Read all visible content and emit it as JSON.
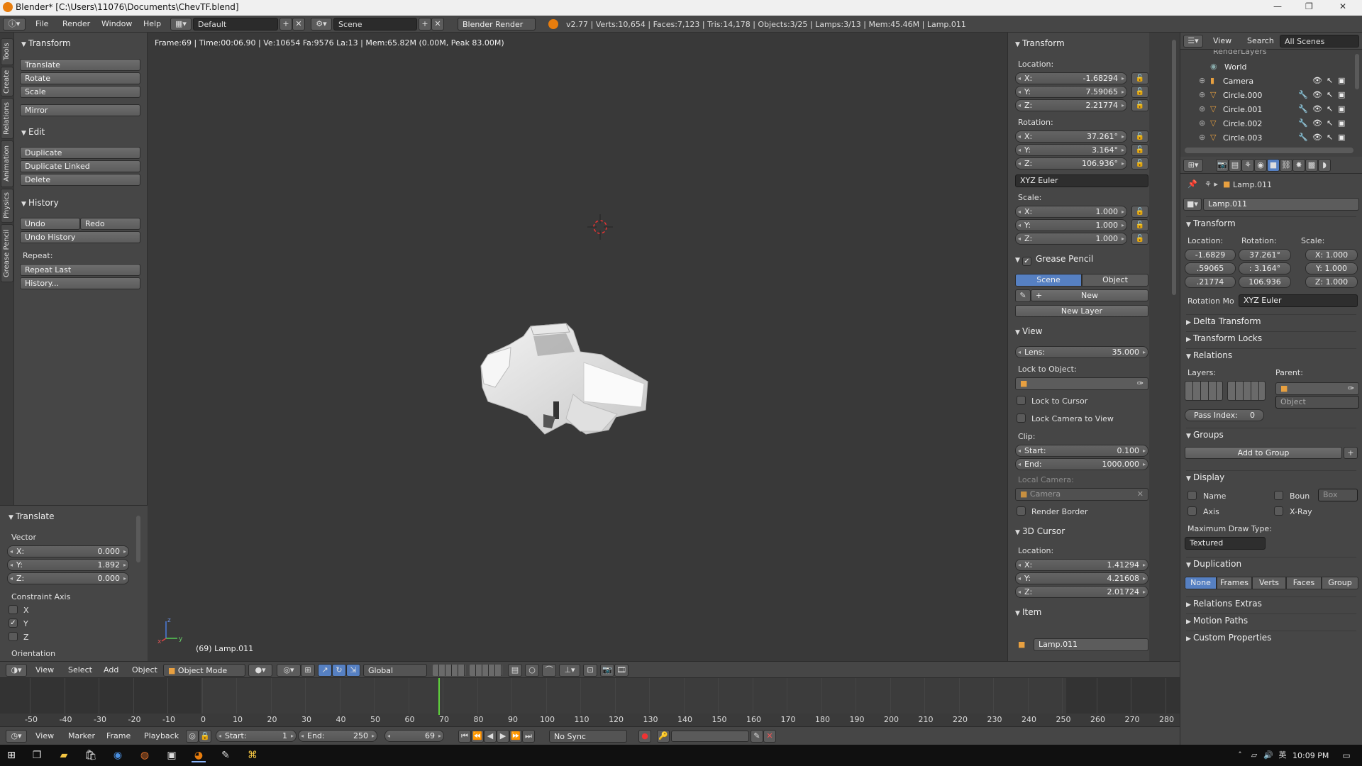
{
  "title_bar": {
    "title": "Blender* [C:\\Users\\11076\\Documents\\ChevTF.blend]",
    "minimize": "—",
    "maximize": "❐",
    "close": "✕"
  },
  "menu": {
    "items": [
      "File",
      "Render",
      "Window",
      "Help"
    ],
    "screen_layout": "Default",
    "scene": "Scene",
    "render_engine": "Blender Render",
    "stats": "v2.77 | Verts:10,654 | Faces:7,123 | Tris:14,178 | Objects:3/25 | Lamps:3/13 | Mem:45.46M | Lamp.011"
  },
  "tab_strip": [
    "Tools",
    "Create",
    "Relations",
    "Animation",
    "Physics",
    "Grease Pencil"
  ],
  "tool_shelf": {
    "transform": {
      "title": "Transform",
      "buttons": [
        "Translate",
        "Rotate",
        "Scale",
        "Mirror"
      ]
    },
    "edit": {
      "title": "Edit",
      "buttons": [
        "Duplicate",
        "Duplicate Linked",
        "Delete"
      ]
    },
    "history": {
      "title": "History",
      "undo": "Undo",
      "redo": "Redo",
      "undo_history": "Undo History",
      "repeat_label": "Repeat:",
      "repeat_last": "Repeat Last",
      "history_btn": "History..."
    },
    "operator": {
      "title": "Translate",
      "vector_label": "Vector",
      "x_key": "X:",
      "x_val": "0.000",
      "y_key": "Y:",
      "y_val": "1.892",
      "z_key": "Z:",
      "z_val": "0.000",
      "constraint_label": "Constraint Axis",
      "cx": "X",
      "cy": "Y",
      "cz": "Z",
      "cx_checked": false,
      "cy_checked": true,
      "cz_checked": false,
      "orientation_label": "Orientation"
    }
  },
  "viewport": {
    "info": "Frame:69 | Time:00:06.90 | Ve:10654 Fa:9576 La:13 | Mem:65.82M (0.00M, Peak 83.00M)",
    "object_label": "(69) Lamp.011",
    "axis_x": "x",
    "axis_z": "z",
    "axis_y": "y"
  },
  "properties_region": {
    "transform": {
      "title": "Transform",
      "location_label": "Location:",
      "loc": [
        {
          "k": "X:",
          "v": "-1.68294"
        },
        {
          "k": "Y:",
          "v": "7.59065"
        },
        {
          "k": "Z:",
          "v": "2.21774"
        }
      ],
      "rotation_label": "Rotation:",
      "rot": [
        {
          "k": "X:",
          "v": "37.261°"
        },
        {
          "k": "Y:",
          "v": "3.164°"
        },
        {
          "k": "Z:",
          "v": "106.936°"
        }
      ],
      "rotation_mode": "XYZ Euler",
      "scale_label": "Scale:",
      "scale": [
        {
          "k": "X:",
          "v": "1.000"
        },
        {
          "k": "Y:",
          "v": "1.000"
        },
        {
          "k": "Z:",
          "v": "1.000"
        }
      ]
    },
    "grease_pencil": {
      "title": "Grease Pencil",
      "scene": "Scene",
      "object": "Object",
      "new": "New",
      "new_layer": "New Layer"
    },
    "view": {
      "title": "View",
      "lens_key": "Lens:",
      "lens_val": "35.000",
      "lock_label": "Lock to Object:",
      "lock_cursor": "Lock to Cursor",
      "lock_camera": "Lock Camera to View",
      "clip_label": "Clip:",
      "start_key": "Start:",
      "start_val": "0.100",
      "end_key": "End:",
      "end_val": "1000.000",
      "local_camera_label": "Local Camera:",
      "local_camera": "Camera",
      "render_border": "Render Border"
    },
    "cursor": {
      "title": "3D Cursor",
      "location_label": "Location:",
      "loc": [
        {
          "k": "X:",
          "v": "1.41294"
        },
        {
          "k": "Y:",
          "v": "4.21608"
        },
        {
          "k": "Z:",
          "v": "2.01724"
        }
      ]
    },
    "item": {
      "title": "Item",
      "name": "Lamp.011"
    }
  },
  "outliner": {
    "view": "View",
    "search": "Search",
    "filter": "All Scenes",
    "rows": [
      "RenderLayers",
      "World",
      "Camera",
      "Circle.000",
      "Circle.001",
      "Circle.002",
      "Circle.003"
    ]
  },
  "properties_editor": {
    "breadcrumb": "Lamp.011",
    "object_name": "Lamp.011",
    "transform_title": "Transform",
    "location_label": "Location:",
    "rotation_label": "Rotation:",
    "scale_label": "Scale:",
    "loc": [
      "-1.6829",
      ".59065",
      ".21774"
    ],
    "rot": [
      "37.261°",
      ": 3.164°",
      "106.936"
    ],
    "scl": [
      "X: 1.000",
      "Y: 1.000",
      "Z: 1.000"
    ],
    "rotation_mode_label": "Rotation Mo",
    "rotation_mode": "XYZ Euler",
    "delta_transform": "Delta Transform",
    "transform_locks": "Transform Locks",
    "relations": "Relations",
    "layers_label": "Layers:",
    "parent_label": "Parent:",
    "parent_type": "Object",
    "pass_index": "Pass Index:",
    "pass_index_val": "0",
    "groups": "Groups",
    "add_to_group": "Add to Group",
    "display": "Display",
    "name": "Name",
    "bounds": "Boun",
    "bounds_type": "Box",
    "axis": "Axis",
    "xray": "X-Ray",
    "max_draw_label": "Maximum Draw Type:",
    "max_draw": "Textured",
    "duplication": "Duplication",
    "dup_options": [
      "None",
      "Frames",
      "Verts",
      "Faces",
      "Group"
    ],
    "relations_extras": "Relations Extras",
    "motion_paths": "Motion Paths",
    "custom_props": "Custom Properties"
  },
  "view3d_header": {
    "menus": [
      "View",
      "Select",
      "Add",
      "Object"
    ],
    "mode": "Object Mode",
    "orientation": "Global"
  },
  "timeline": {
    "ticks": [
      "-50",
      "-40",
      "-30",
      "-20",
      "-10",
      "0",
      "10",
      "20",
      "30",
      "40",
      "50",
      "60",
      "70",
      "80",
      "90",
      "100",
      "110",
      "120",
      "130",
      "140",
      "150",
      "160",
      "170",
      "180",
      "190",
      "200",
      "210",
      "220",
      "230",
      "240",
      "250",
      "260",
      "270",
      "280"
    ],
    "menus": [
      "View",
      "Marker",
      "Frame",
      "Playback"
    ],
    "start_key": "Start:",
    "start_val": "1",
    "end_key": "End:",
    "end_val": "250",
    "current": "69",
    "sync": "No Sync"
  },
  "taskbar": {
    "time": "10:09 PM"
  }
}
